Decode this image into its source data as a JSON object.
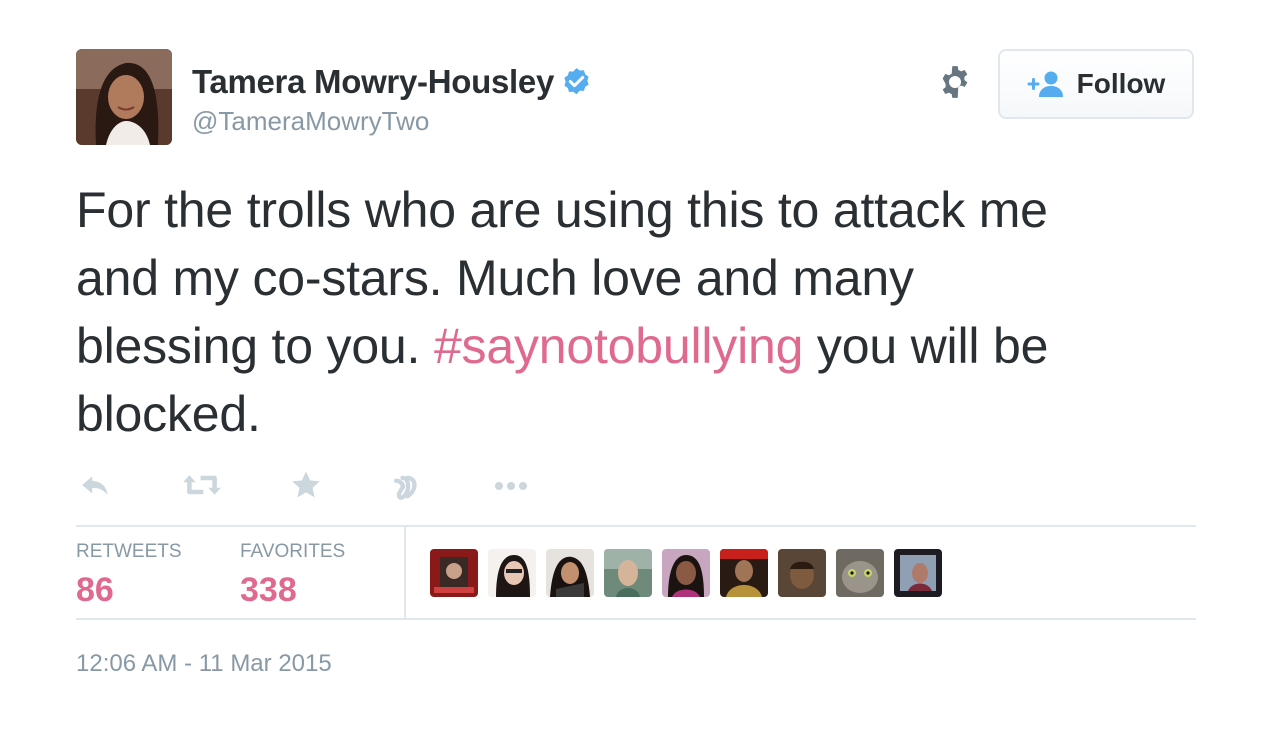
{
  "user": {
    "display_name": "Tamera Mowry-Housley",
    "handle": "@TameraMowryTwo",
    "verified": true,
    "avatar_icon": "profile-photo"
  },
  "header": {
    "settings_icon": "gear-icon",
    "follow_label": "Follow",
    "follow_icon": "add-user-icon"
  },
  "tweet": {
    "text_line1": "For the trolls who are using this to attack me",
    "text_line2": "and my co-stars.  Much love and many",
    "text_line3_before": "blessing to you. ",
    "hashtag": "#saynotobullying",
    "text_line3_after": " you will be",
    "text_line4": "blocked."
  },
  "actions": [
    {
      "name": "reply",
      "icon": "reply-icon"
    },
    {
      "name": "retweet",
      "icon": "retweet-icon"
    },
    {
      "name": "favorite",
      "icon": "star-icon"
    },
    {
      "name": "vine",
      "icon": "vine-icon"
    },
    {
      "name": "more",
      "icon": "more-icon"
    }
  ],
  "stats": {
    "retweets_label": "RETWEETS",
    "retweets_value": "86",
    "favorites_label": "FAVORITES",
    "favorites_value": "338"
  },
  "favoriters_count_shown": 9,
  "timestamp": "12:06 AM - 11 Mar 2015",
  "colors": {
    "accent_pink": "#e0698f",
    "text": "#292f33",
    "muted": "#8899a6",
    "verified_blue": "#55acee",
    "border": "#e1e8ed"
  }
}
